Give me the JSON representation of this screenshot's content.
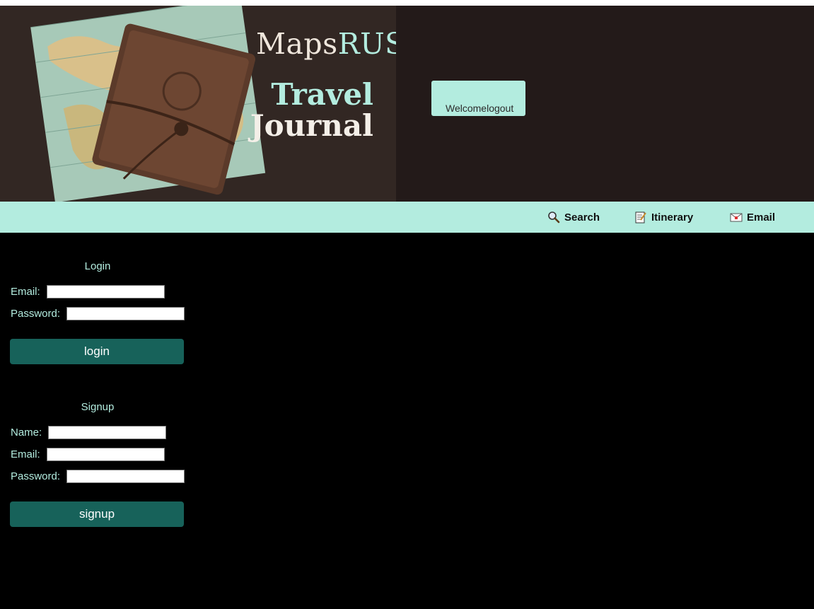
{
  "header": {
    "brand_part1": "Maps",
    "brand_part2": "RUS",
    "banner_line1": "Travel",
    "banner_line2": "Journal",
    "welcome_text": "Welcomelogout"
  },
  "nav": {
    "items": [
      {
        "label": "Search",
        "icon": "magnifier-icon"
      },
      {
        "label": "Itinerary",
        "icon": "memo-icon"
      },
      {
        "label": "Email",
        "icon": "envelope-icon"
      }
    ]
  },
  "login": {
    "title": "Login",
    "email_label": "Email:",
    "email_value": "",
    "password_label": "Password:",
    "password_value": "",
    "button_label": "login"
  },
  "signup": {
    "title": "Signup",
    "name_label": "Name:",
    "name_value": "",
    "email_label": "Email:",
    "email_value": "",
    "password_label": "Password:",
    "password_value": "",
    "button_label": "signup"
  },
  "colors": {
    "accent": "#b3ecdf",
    "button": "#17625a",
    "header_bg": "#231a19",
    "page_bg": "#000000"
  }
}
